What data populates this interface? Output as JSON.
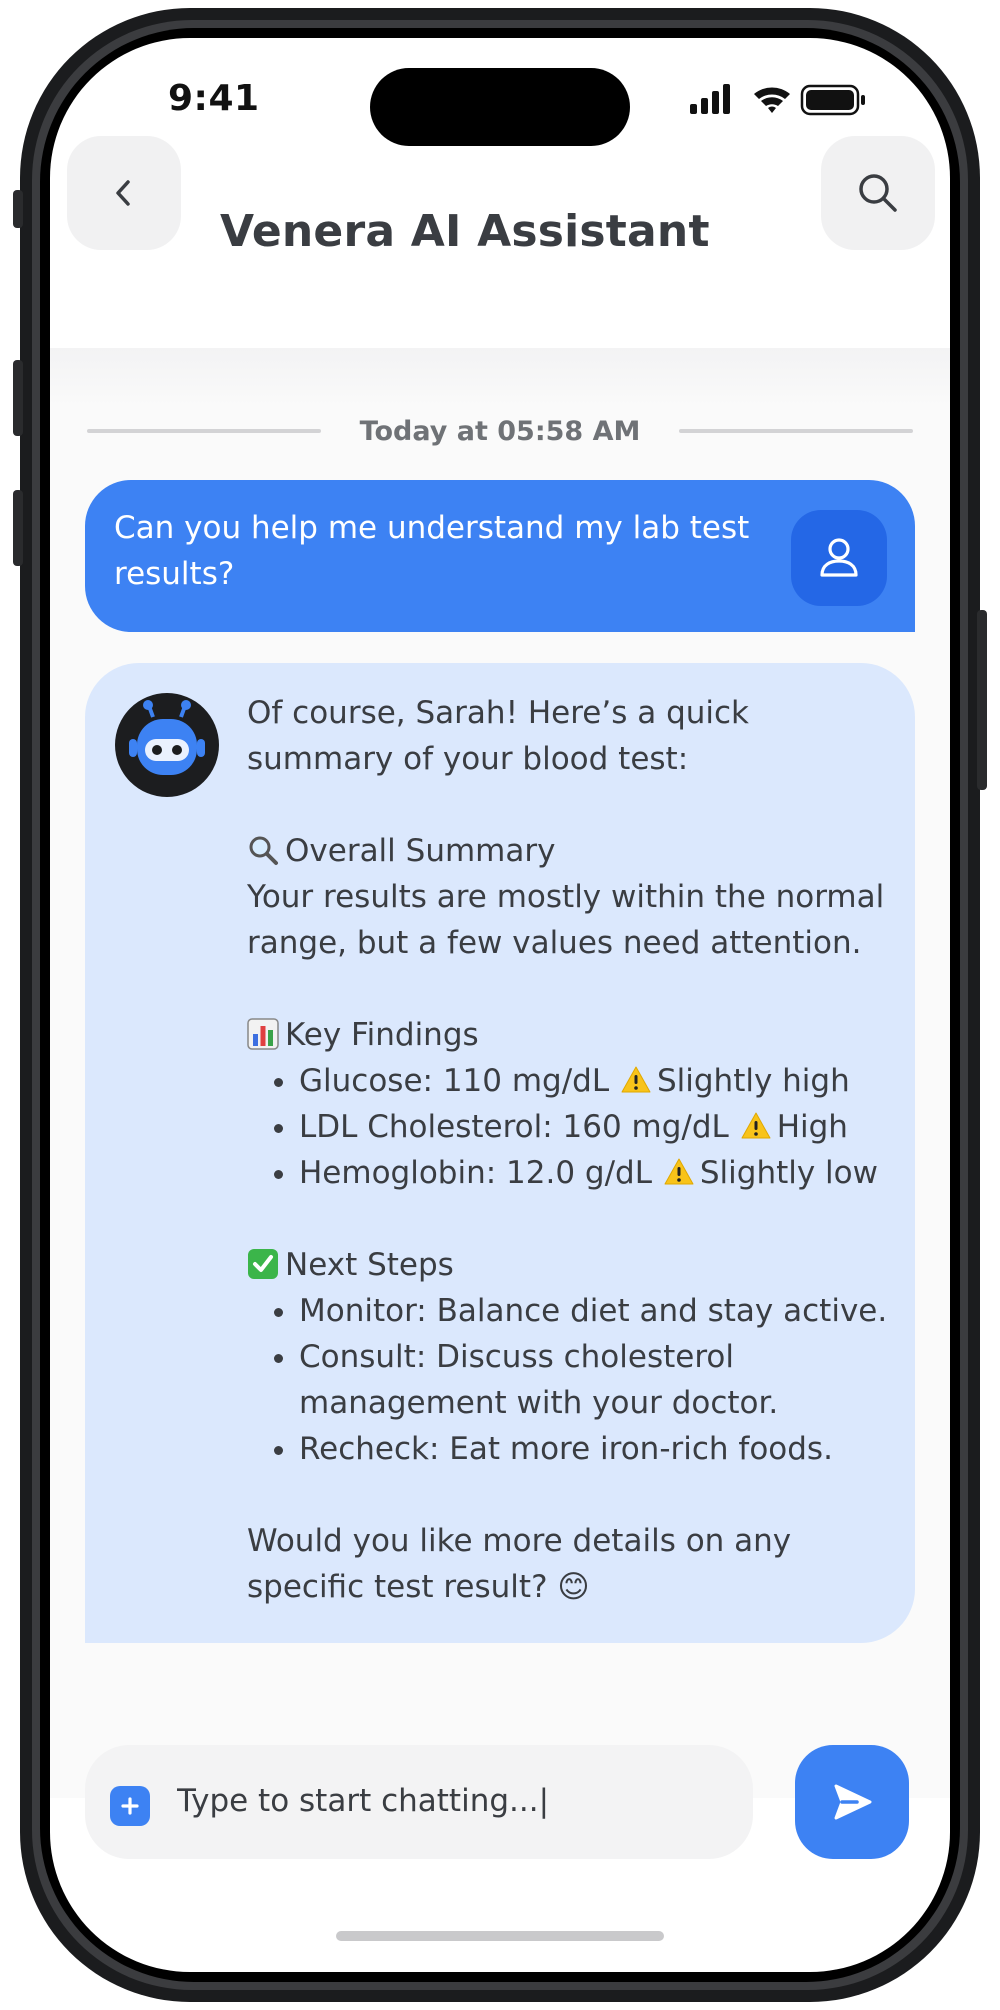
{
  "status_bar": {
    "time": "9:41",
    "icons": [
      "signal-icon",
      "wifi-icon",
      "battery-icon"
    ]
  },
  "header": {
    "back_icon": "chevron-left-icon",
    "title": "Venera AI Assistant",
    "search_icon": "search-icon"
  },
  "chat": {
    "date_label": "Today at 05:58 AM",
    "user_message": {
      "text": "Can you help me understand my lab test results?",
      "avatar_icon": "user-icon"
    },
    "bot_message": {
      "avatar_icon": "robot-icon",
      "intro": "Of course, Sarah! Here’s a quick summary of your blood test:",
      "summary_title": "Overall Summary",
      "summary_icon": "magnifier-emoji",
      "summary_text": "Your results are mostly within the normal range, but a few values need attention.",
      "findings_title": "Key Findings",
      "findings_icon": "bar-chart-emoji",
      "findings": [
        {
          "label": "Glucose: 110 mg/dL",
          "flag": "Slightly high",
          "icon": "warning-emoji"
        },
        {
          "label": "LDL Cholesterol: 160 mg/dL",
          "flag": "High",
          "icon": "warning-emoji"
        },
        {
          "label": "Hemoglobin: 12.0 g/dL",
          "flag": "Slightly low",
          "icon": "warning-emoji"
        }
      ],
      "steps_title": "Next Steps",
      "steps_icon": "check-mark-emoji",
      "steps": [
        "Monitor: Balance diet and stay active.",
        "Consult: Discuss cholesterol management with your doctor.",
        "Recheck: Eat more iron-rich foods."
      ],
      "closing": "Would you like more details on any specific test result? 😊"
    }
  },
  "composer": {
    "plus_icon": "plus-icon",
    "value": "Type to start chatting...|",
    "send_icon": "send-icon"
  },
  "colors": {
    "accent": "#3d82f3",
    "bot_bubble": "#dbe8fd",
    "text": "#3a3d42"
  }
}
